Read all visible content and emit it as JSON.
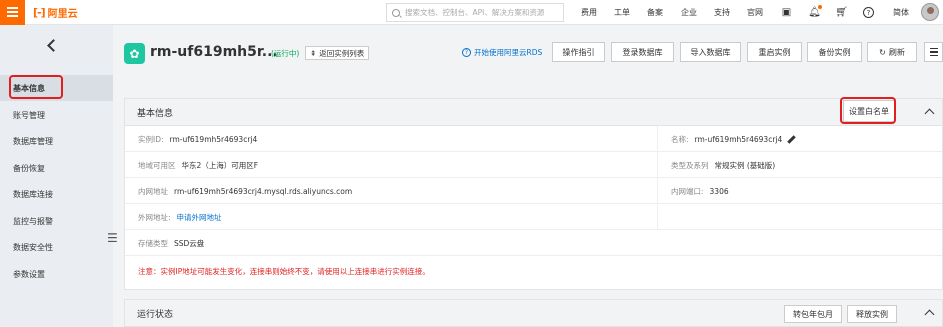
{
  "topbar": {
    "logo_mark": "[-]",
    "logo_text": "阿里云",
    "search_placeholder": "搜索文档、控制台、API、解决方案和资源",
    "nav": [
      "费用",
      "工单",
      "备案",
      "企业",
      "支持",
      "官网"
    ],
    "lang": "简体"
  },
  "sidebar": {
    "items": [
      {
        "label": "基本信息",
        "active": true
      },
      {
        "label": "账号管理"
      },
      {
        "label": "数据库管理"
      },
      {
        "label": "备份恢复"
      },
      {
        "label": "数据库连接"
      },
      {
        "label": "监控与报警"
      },
      {
        "label": "数据安全性"
      },
      {
        "label": "参数设置"
      }
    ]
  },
  "header": {
    "title": "rm-uf619mh5r...",
    "status": "(运行中)",
    "back_label": "返回实例列表",
    "rds_link": "开始使用阿里云RDS",
    "buttons": [
      "操作指引",
      "登录数据库",
      "导入数据库",
      "重启实例",
      "备份实例",
      "刷新"
    ]
  },
  "basic_panel": {
    "title": "基本信息",
    "whitelist_button": "设置白名单",
    "rows": [
      {
        "l_label": "实例ID:",
        "l_value": "rm-uf619mh5r4693crj4",
        "r_label": "名称:",
        "r_value": "rm-uf619mh5r4693crj4"
      },
      {
        "l_label": "地域可用区",
        "l_value": "华东2（上海）可用区F",
        "r_label": "类型及系列",
        "r_value": "常规实例 (基础版)"
      },
      {
        "l_label": "内网地址",
        "l_value": "rm-uf619mh5r4693crj4.mysql.rds.aliyuncs.com",
        "r_label": "内网端口:",
        "r_value": "3306"
      },
      {
        "l_label": "外网地址:",
        "l_value": "申请外网地址"
      },
      {
        "l_label": "存储类型",
        "l_value": "SSD云盘"
      }
    ],
    "warning": "注意：实例IP地址可能发生变化，连接串则始终不变，请使用以上连接串进行实例连接。"
  },
  "status_panel": {
    "title": "运行状态",
    "buttons": [
      "转包年包月",
      "释放实例"
    ]
  },
  "colors": {
    "brand": "#ff6a00",
    "highlight": "#e02020",
    "link": "#0070cc",
    "running": "#00a854"
  }
}
